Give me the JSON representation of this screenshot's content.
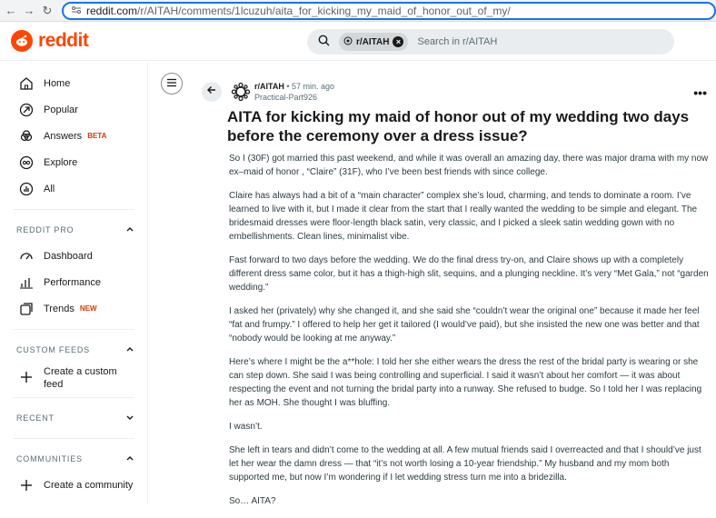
{
  "browser": {
    "url_domain": "reddit.com",
    "url_path": "/r/AITAH/comments/1lcuzuh/aita_for_kicking_my_maid_of_honor_out_of_my/"
  },
  "header": {
    "logo_text": "reddit",
    "search_chip": "r/AITAH",
    "search_placeholder": "Search in r/AITAH"
  },
  "sidebar": {
    "main_items": [
      {
        "label": "Home",
        "icon": "home-icon"
      },
      {
        "label": "Popular",
        "icon": "popular-icon"
      },
      {
        "label": "Answers",
        "icon": "answers-icon",
        "badge": "BETA"
      },
      {
        "label": "Explore",
        "icon": "explore-icon"
      },
      {
        "label": "All",
        "icon": "all-icon"
      }
    ],
    "reddit_pro": {
      "header": "REDDIT PRO",
      "items": [
        {
          "label": "Dashboard",
          "icon": "dashboard-icon"
        },
        {
          "label": "Performance",
          "icon": "performance-icon"
        },
        {
          "label": "Trends",
          "icon": "trends-icon",
          "badge": "NEW"
        }
      ]
    },
    "custom_feeds": {
      "header": "CUSTOM FEEDS",
      "create_label": "Create a custom feed"
    },
    "recent": {
      "header": "RECENT"
    },
    "communities": {
      "header": "COMMUNITIES",
      "create_label": "Create a community"
    }
  },
  "post": {
    "subreddit": "r/AITAH",
    "age": "57 min. ago",
    "author": "Practical-Part926",
    "more_label": "•••",
    "title": "AITA for kicking my maid of honor out of my wedding two days before the ceremony over a dress issue?",
    "paragraphs": [
      "So I (30F) got married this past weekend, and while it was overall an amazing day, there was major drama with my now ex–maid of honor , “Claire” (31F), who I’ve been best friends with since college.",
      "Claire has always had a bit of a “main character” complex she’s loud, charming, and tends to dominate a room. I’ve learned to live with it, but I made it clear from the start that I really wanted the wedding to be simple and elegant. The bridesmaid dresses were floor-length black satin, very classic, and I picked a sleek satin wedding gown with no embellishments. Clean lines, minimalist vibe.",
      "Fast forward to two days before the wedding. We do the final dress try-on, and Claire shows up with a completely different dress same color, but it has a thigh-high slit, sequins, and a plunging neckline. It’s very “Met Gala,” not “garden wedding.”",
      "I asked her (privately) why she changed it, and she said she “couldn’t wear the original one” because it made her feel “fat and frumpy.” I offered to help her get it tailored (I would’ve paid), but she insisted the new one was better and that “nobody would be looking at me anyway.”",
      "Here’s where I might be the a**hole: I told her she either wears the dress the rest of the bridal party is wearing or she can step down. She said I was being controlling and superficial. I said it wasn’t about her comfort — it was about respecting the event and not turning the bridal party into a runway. She refused to budge. So I told her I was replacing her as MOH. She thought I was bluffing.",
      "I wasn’t.",
      "She left in tears and didn’t come to the wedding at all. A few mutual friends said I overreacted and that I should’ve just let her wear the damn dress — that “it’s not worth losing a 10-year friendship.” My husband and my mom both supported me, but now I’m wondering if I let wedding stress turn me into a bridezilla.",
      "So… AITA?"
    ]
  },
  "colors": {
    "brand": "#ff4500",
    "beta_badge": "#d93900",
    "url_focus": "#1a73e8"
  }
}
